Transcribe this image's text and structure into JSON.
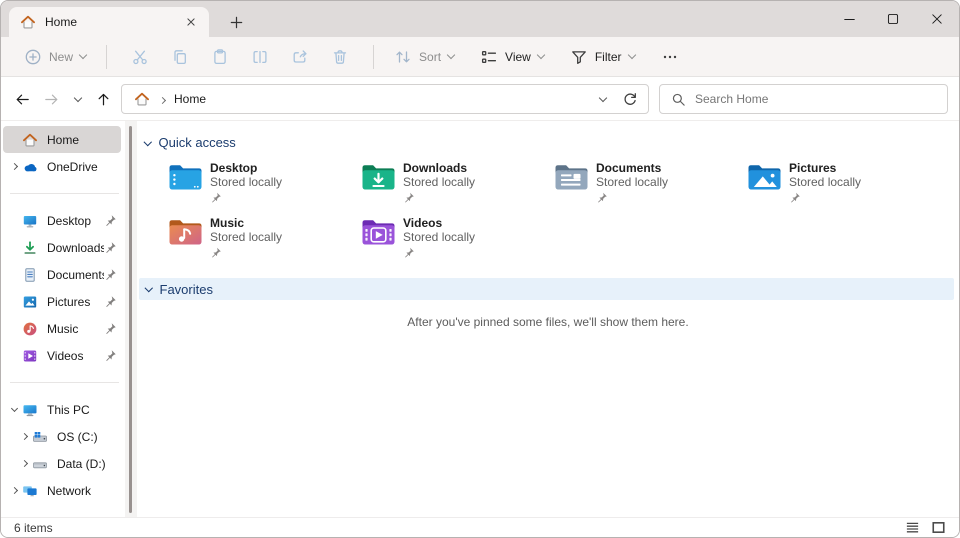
{
  "tab": {
    "title": "Home"
  },
  "toolbar": {
    "new": "New",
    "sort": "Sort",
    "view": "View",
    "filter": "Filter"
  },
  "address": {
    "root": "Home"
  },
  "search": {
    "placeholder": "Search Home"
  },
  "sidebar": {
    "items": [
      {
        "label": "Home",
        "icon": "home16",
        "selected": true
      },
      {
        "label": "OneDrive",
        "icon": "onedrive16",
        "chevron": "right"
      },
      {
        "separator": true
      },
      {
        "label": "Desktop",
        "icon": "desktop16",
        "pinned": true
      },
      {
        "label": "Downloads",
        "icon": "downloads16",
        "pinned": true
      },
      {
        "label": "Documents",
        "icon": "documents16",
        "pinned": true
      },
      {
        "label": "Pictures",
        "icon": "pictures16",
        "pinned": true
      },
      {
        "label": "Music",
        "icon": "music16",
        "pinned": true
      },
      {
        "label": "Videos",
        "icon": "videos16",
        "pinned": true
      },
      {
        "separator": true
      },
      {
        "label": "This PC",
        "icon": "thispc16",
        "chevron": "down"
      },
      {
        "label": "OS (C:)",
        "icon": "osdrive16",
        "chevron": "right",
        "indent": 1
      },
      {
        "label": "Data (D:)",
        "icon": "datadrive16",
        "chevron": "right",
        "indent": 1
      },
      {
        "label": "Network",
        "icon": "network16",
        "chevron": "right"
      },
      {
        "label": "",
        "icon": "partial16",
        "partial": true
      }
    ]
  },
  "quick_access": {
    "title": "Quick access",
    "tiles": [
      {
        "name": "Desktop",
        "status": "Stored locally",
        "icon": "folder-desktop"
      },
      {
        "name": "Downloads",
        "status": "Stored locally",
        "icon": "folder-downloads"
      },
      {
        "name": "Documents",
        "status": "Stored locally",
        "icon": "folder-documents"
      },
      {
        "name": "Pictures",
        "status": "Stored locally",
        "icon": "folder-pictures"
      },
      {
        "name": "Music",
        "status": "Stored locally",
        "icon": "folder-music"
      },
      {
        "name": "Videos",
        "status": "Stored locally",
        "icon": "folder-videos"
      }
    ]
  },
  "favorites": {
    "title": "Favorites",
    "empty_message": "After you've pinned some files, we'll show them here."
  },
  "status_bar": {
    "items_count": "6 items"
  },
  "colors": {
    "titlebar_bg": "#dfdbda",
    "surface_bg": "#f7f4f3",
    "selection_bg": "#d9d6d5",
    "section_header_text": "#1b3c6e",
    "favorites_band_bg": "#e7f1fa",
    "disabled_icon_blue": "#a9c3dd"
  }
}
